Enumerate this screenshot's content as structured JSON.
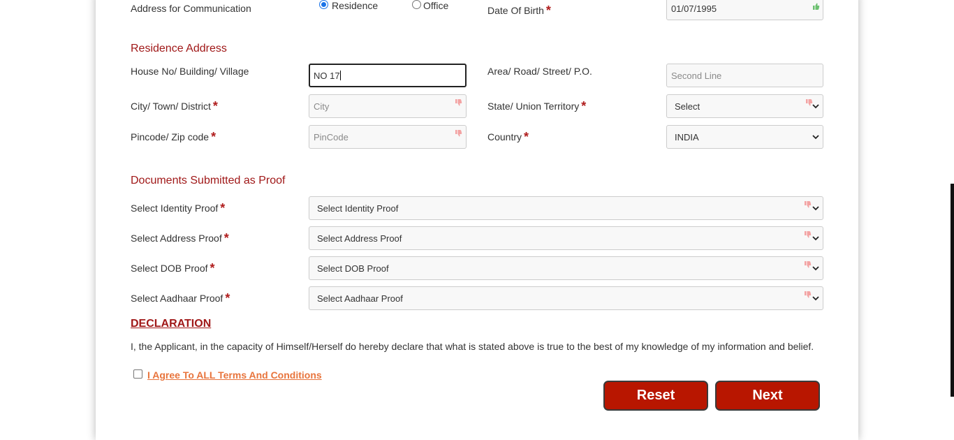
{
  "form": {
    "communication": {
      "label": "Address for Communication",
      "options": [
        "Residence",
        "Office"
      ],
      "selected": "Residence"
    },
    "dob": {
      "label": "Date Of Birth",
      "value": "01/07/1995"
    },
    "residence_section": {
      "title": "Residence Address",
      "house": {
        "label": "House No/ Building/ Village",
        "value": "NO 17"
      },
      "area": {
        "label": "Area/ Road/ Street/ P.O.",
        "placeholder": "Second Line"
      },
      "city": {
        "label": "City/ Town/ District",
        "placeholder": "City"
      },
      "state": {
        "label": "State/ Union Territory",
        "value": "Select"
      },
      "pincode": {
        "label": "Pincode/ Zip code",
        "placeholder": "PinCode"
      },
      "country": {
        "label": "Country",
        "value": "INDIA"
      }
    },
    "documents_section": {
      "title": "Documents Submitted as Proof",
      "identity": {
        "label": "Select Identity Proof",
        "value": "Select Identity Proof"
      },
      "address": {
        "label": "Select Address Proof",
        "value": "Select Address Proof"
      },
      "dob": {
        "label": "Select DOB Proof",
        "value": "Select DOB Proof"
      },
      "aadhaar": {
        "label": "Select Aadhaar Proof",
        "value": "Select Aadhaar Proof"
      }
    },
    "declaration": {
      "title": "DECLARATION",
      "text": "I, the Applicant, in the capacity of Himself/Herself do hereby declare that what is stated above is true to the best of my knowledge of my information and belief.",
      "agree_label": "I Agree To ALL Terms And Conditions",
      "agree_checked": false
    },
    "buttons": {
      "reset": "Reset",
      "next": "Next"
    },
    "required_marker": "*"
  },
  "colors": {
    "section_title": "#a01818",
    "required": "#b01d1d",
    "button": "#b81600",
    "link": "#e8743c",
    "radio_selected": "#1a73e8"
  },
  "icons": {
    "validation_invalid": "thumbs-down-icon",
    "validation_valid": "thumbs-up-icon",
    "dropdown": "chevron-down-icon"
  }
}
